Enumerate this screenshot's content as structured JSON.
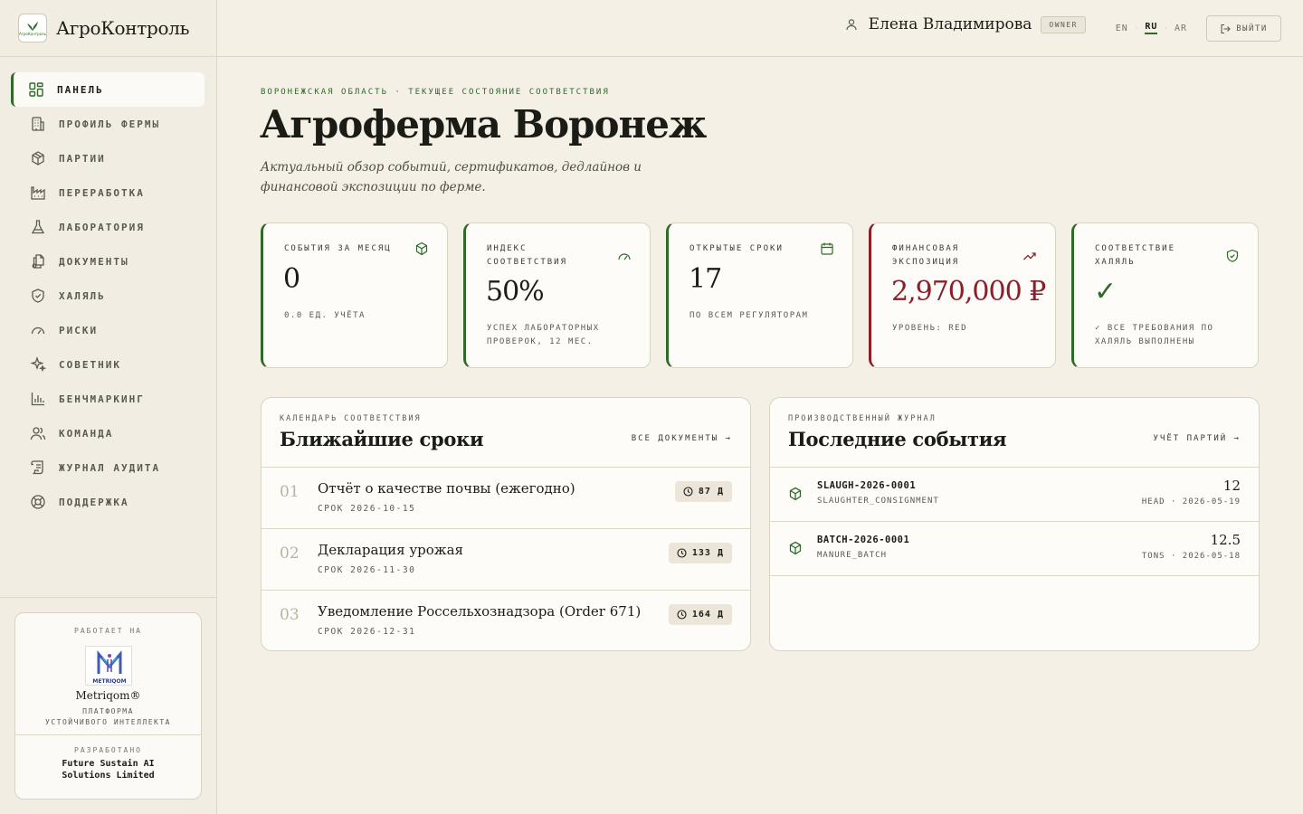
{
  "app": {
    "name": "АгроКонтроль"
  },
  "colors": {
    "accent": "#2e6b2a",
    "danger": "#8a1f2b",
    "background": "#f4f0e6",
    "card": "#fdfcf8"
  },
  "sidebar": {
    "items": [
      {
        "label": "ПАНЕЛЬ",
        "icon": "dashboard-icon",
        "active": true
      },
      {
        "label": "ПРОФИЛЬ ФЕРМЫ",
        "icon": "building-icon"
      },
      {
        "label": "ПАРТИИ",
        "icon": "box-icon"
      },
      {
        "label": "ПЕРЕРАБОТКА",
        "icon": "factory-icon"
      },
      {
        "label": "ЛАБОРАТОРИЯ",
        "icon": "flask-icon"
      },
      {
        "label": "ДОКУМЕНТЫ",
        "icon": "documents-icon"
      },
      {
        "label": "ХАЛЯЛЬ",
        "icon": "shield-icon"
      },
      {
        "label": "РИСКИ",
        "icon": "gauge-icon"
      },
      {
        "label": "СОВЕТНИК",
        "icon": "sparkles-icon"
      },
      {
        "label": "БЕНЧМАРКИНГ",
        "icon": "bar-chart-icon"
      },
      {
        "label": "КОМАНДА",
        "icon": "users-icon"
      },
      {
        "label": "ЖУРНАЛ АУДИТА",
        "icon": "scroll-icon"
      },
      {
        "label": "ПОДДЕРЖКА",
        "icon": "lifebuoy-icon"
      }
    ],
    "powered": {
      "caption": "РАБОТАЕТ НА",
      "logo_text": "METRIQOM",
      "name": "Metriqom®",
      "subtitle_1": "ПЛАТФОРМА",
      "subtitle_2": "УСТОЙЧИВОГО ИНТЕЛЛЕКТА",
      "dev_caption": "РАЗРАБОТАНО",
      "dev_name_1": "Future Sustain AI",
      "dev_name_2": "Solutions Limited"
    }
  },
  "header": {
    "user_name": "Елена Владимирова",
    "role": "OWNER",
    "langs": [
      "EN",
      "RU",
      "AR"
    ],
    "active_lang": "RU",
    "logout_label": "ВЫЙТИ"
  },
  "main": {
    "eyebrow": "ВОРОНЕЖСКАЯ ОБЛАСТЬ · ТЕКУЩЕЕ СОСТОЯНИЕ СООТВЕТСТВИЯ",
    "title": "Агроферма Воронеж",
    "subtitle": "Актуальный обзор событий, сертификатов, дедлайнов и финансовой экспозиции по ферме.",
    "kpis": [
      {
        "label": "СОБЫТИЯ ЗА МЕСЯЦ",
        "value": "0",
        "note": "0.0 ЕД. УЧЁТА",
        "icon": "box-icon"
      },
      {
        "label": "ИНДЕКС СООТВЕТСТВИЯ",
        "value": "50%",
        "note": "УСПЕХ ЛАБОРАТОРНЫХ ПРОВЕРОК, 12 МЕС.",
        "icon": "gauge-icon"
      },
      {
        "label": "ОТКРЫТЫЕ СРОКИ",
        "value": "17",
        "note": "ПО ВСЕМ РЕГУЛЯТОРАМ",
        "icon": "calendar-icon"
      },
      {
        "label": "ФИНАНСОВАЯ ЭКСПОЗИЦИЯ",
        "value": "2,970,000 ₽",
        "note": "УРОВЕНЬ: RED",
        "icon": "trend-up-icon"
      },
      {
        "label": "СООТВЕТСТВИЕ ХАЛЯЛЬ",
        "value": "✓",
        "note": "✓ ВСЕ ТРЕБОВАНИЯ ПО ХАЛЯЛЬ ВЫПОЛНЕНЫ",
        "icon": "shield-check-icon"
      }
    ],
    "deadlines": {
      "eyebrow": "КАЛЕНДАРЬ СООТВЕТСТВИЯ",
      "title": "Ближайшие сроки",
      "link": "ВСЕ ДОКУМЕНТЫ →",
      "items": [
        {
          "num": "01",
          "title": "Отчёт о качестве почвы (ежегодно)",
          "date": "СРОК 2026-10-15",
          "days": "87 Д"
        },
        {
          "num": "02",
          "title": "Декларация урожая",
          "date": "СРОК 2026-11-30",
          "days": "133 Д"
        },
        {
          "num": "03",
          "title": "Уведомление Россельхознадзора (Order 671)",
          "date": "СРОК 2026-12-31",
          "days": "164 Д"
        }
      ]
    },
    "events": {
      "eyebrow": "ПРОИЗВОДСТВЕННЫЙ ЖУРНАЛ",
      "title": "Последние события",
      "link": "УЧЁТ ПАРТИЙ →",
      "items": [
        {
          "code": "SLAUGH-2026-0001",
          "type": "SLAUGHTER_CONSIGNMENT",
          "qty": "12",
          "meta": "HEAD · 2026-05-19"
        },
        {
          "code": "BATCH-2026-0001",
          "type": "MANURE_BATCH",
          "qty": "12.5",
          "meta": "TONS · 2026-05-18"
        }
      ]
    }
  }
}
